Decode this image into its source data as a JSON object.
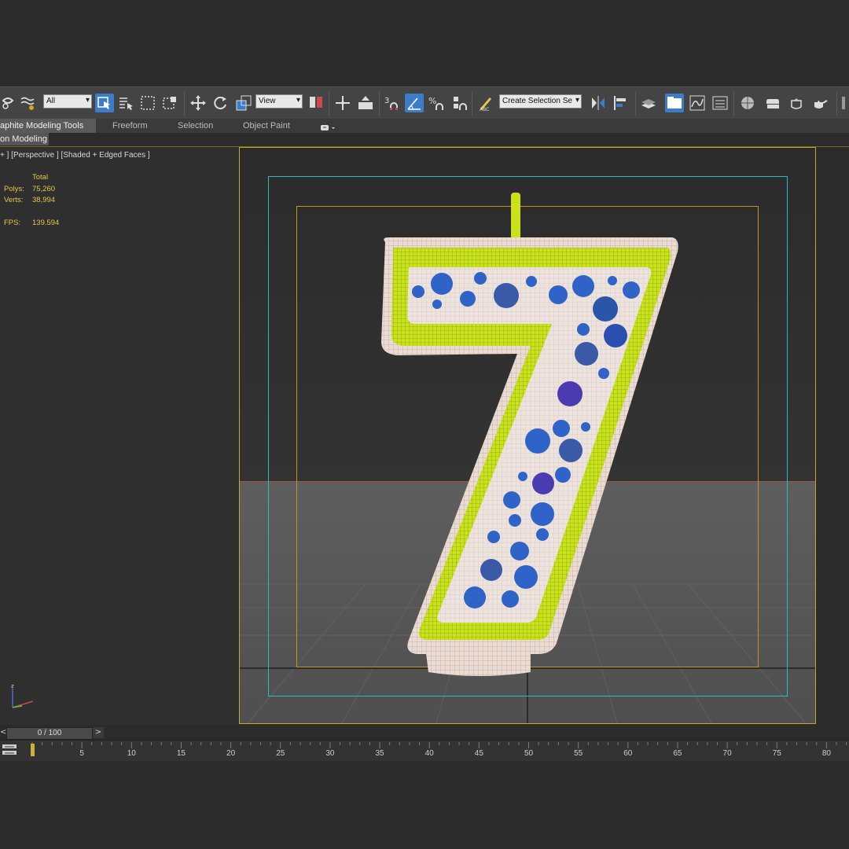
{
  "toolbar": {
    "selection_filter": "All",
    "reference_coord": "View",
    "snap_label": "3",
    "named_selection_placeholder": "Create Selection Se"
  },
  "ribbon": {
    "tabs": [
      "aphite Modeling Tools",
      "Freeform",
      "Selection",
      "Object Paint"
    ],
    "subtab": "on Modeling"
  },
  "viewport": {
    "label": "+ ] [Perspective ] [Shaded + Edged Faces ]",
    "stats": {
      "total_label": "Total",
      "polys_label": "Polys:",
      "polys_value": "75,260",
      "verts_label": "Verts:",
      "verts_value": "38,994",
      "fps_label": "FPS:",
      "fps_value": "139.594"
    },
    "axis_z_label": "z"
  },
  "timeline": {
    "slider_text": "0 / 100",
    "prev": "<",
    "next": ">",
    "ticks": [
      "5",
      "10",
      "15",
      "20",
      "25",
      "30",
      "35",
      "40",
      "45",
      "50",
      "55",
      "60",
      "65",
      "70",
      "75",
      "80"
    ]
  },
  "colors": {
    "accent": "#3d7cc9",
    "safe_frame": "#c6a92a",
    "stats_text": "#e6c84a",
    "candle_green": "#c9e21b",
    "candle_cream": "#e9dcd4",
    "dot_blue": "#2f63c8"
  }
}
